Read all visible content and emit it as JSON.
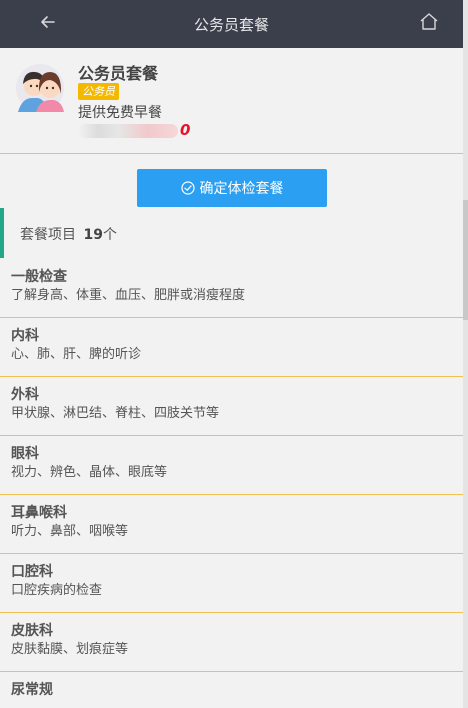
{
  "header": {
    "title": "公务员套餐",
    "back_icon": "arrow-left-icon",
    "home_icon": "home-icon"
  },
  "package": {
    "name": "公务员套餐",
    "tag": "公务员",
    "description": "提供免费早餐",
    "price_visible": "0"
  },
  "confirm_button": {
    "label": "确定体检套餐",
    "icon": "check-circle-icon"
  },
  "items_section": {
    "label": "套餐项目",
    "count": "19",
    "unit": "个"
  },
  "items": [
    {
      "name": "一般检查",
      "desc": "了解身高、体重、血压、肥胖或消瘦程度"
    },
    {
      "name": "内科",
      "desc": "心、肺、肝、脾的听诊"
    },
    {
      "name": "外科",
      "desc": "甲状腺、淋巴结、脊柱、四肢关节等"
    },
    {
      "name": "眼科",
      "desc": "视力、辨色、晶体、眼底等"
    },
    {
      "name": "耳鼻喉科",
      "desc": "听力、鼻部、咽喉等"
    },
    {
      "name": "口腔科",
      "desc": "口腔疾病的检查"
    },
    {
      "name": "皮肤科",
      "desc": "皮肤黏膜、划痕症等"
    },
    {
      "name": "尿常规",
      "desc": ""
    }
  ],
  "colors": {
    "topbar": "#3b3f4c",
    "accent_blue": "#2b9ff2",
    "divider": "#f0c050",
    "tag": "#f5b800",
    "section_bar": "#22a889"
  }
}
